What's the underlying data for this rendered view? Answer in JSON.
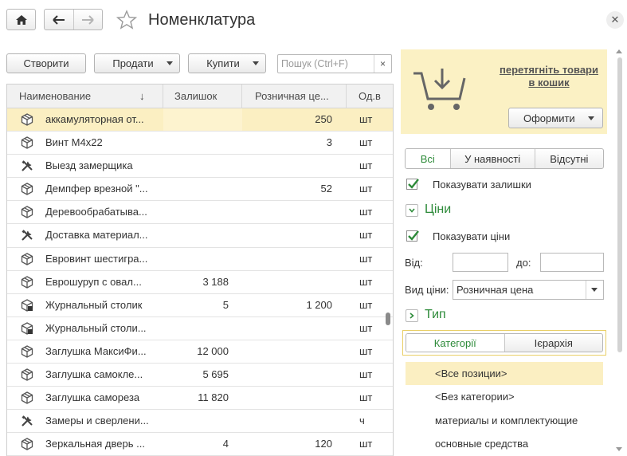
{
  "window": {
    "title": "Номенклатура"
  },
  "toolbar": {
    "create_label": "Створити",
    "sell_label": "Продати",
    "buy_label": "Купити",
    "search_placeholder": "Пошук (Ctrl+F)"
  },
  "table": {
    "columns": [
      "Наименование",
      "Залишок",
      "Розничная це...",
      "Од.в"
    ],
    "sort_indicator": "↓",
    "rows": [
      {
        "icon": "box-icon",
        "name": "аккамуляторная от...",
        "qty": "",
        "price": "250",
        "unit": "шт",
        "selected": true
      },
      {
        "icon": "box-icon",
        "name": "Винт М4х22",
        "qty": "",
        "price": "3",
        "unit": "шт"
      },
      {
        "icon": "tools-icon",
        "name": "Выезд замерщика",
        "qty": "",
        "price": "",
        "unit": "шт"
      },
      {
        "icon": "box-icon",
        "name": "Демпфер врезной \"...",
        "qty": "",
        "price": "52",
        "unit": "шт"
      },
      {
        "icon": "box-icon",
        "name": "Деревообрабатыва...",
        "qty": "",
        "price": "",
        "unit": "шт"
      },
      {
        "icon": "tools-icon",
        "name": "Доставка материал...",
        "qty": "",
        "price": "",
        "unit": "шт"
      },
      {
        "icon": "box-icon",
        "name": "Евровинт шестигра...",
        "qty": "",
        "price": "",
        "unit": "шт"
      },
      {
        "icon": "box-icon",
        "name": "Еврошуруп с овал...",
        "qty": "3 188",
        "price": "",
        "unit": "шт"
      },
      {
        "icon": "set-icon",
        "name": "Журнальный столик",
        "qty": "5",
        "price": "1 200",
        "unit": "шт"
      },
      {
        "icon": "set-icon",
        "name": "Журнальный столи...",
        "qty": "",
        "price": "",
        "unit": "шт"
      },
      {
        "icon": "box-icon",
        "name": "Заглушка МаксиФи...",
        "qty": "12 000",
        "price": "",
        "unit": "шт"
      },
      {
        "icon": "box-icon",
        "name": "Заглушка самокле...",
        "qty": "5 695",
        "price": "",
        "unit": "шт"
      },
      {
        "icon": "box-icon",
        "name": "Заглушка самореза",
        "qty": "11 820",
        "price": "",
        "unit": "шт"
      },
      {
        "icon": "tools-icon",
        "name": "Замеры и сверлени...",
        "qty": "",
        "price": "",
        "unit": "ч"
      },
      {
        "icon": "box-icon",
        "name": "Зеркальная дверь ...",
        "qty": "4",
        "price": "120",
        "unit": "шт"
      }
    ]
  },
  "cart": {
    "drag_text": "перетягніть товари в кошик",
    "order_label": "Оформити"
  },
  "filters": {
    "stock_tabs": [
      "Всі",
      "У наявності",
      "Відсутні"
    ],
    "show_stock_label": "Показувати залишки",
    "prices_title": "Ціни",
    "show_prices_label": "Показувати ціни",
    "from_label": "Від:",
    "to_label": "до:",
    "price_type_label": "Вид ціни:",
    "price_type_value": "Розничная цена",
    "type_title": "Тип",
    "view_tabs": [
      "Категорії",
      "Ієрархія"
    ],
    "categories": [
      "<Все позиции>",
      "<Без категории>",
      "материалы и комплектующие",
      "основные средства"
    ]
  },
  "colors": {
    "accent_green": "#2e8b3a",
    "selection": "#fbefc2",
    "cart_bg": "#fbf1c4"
  }
}
